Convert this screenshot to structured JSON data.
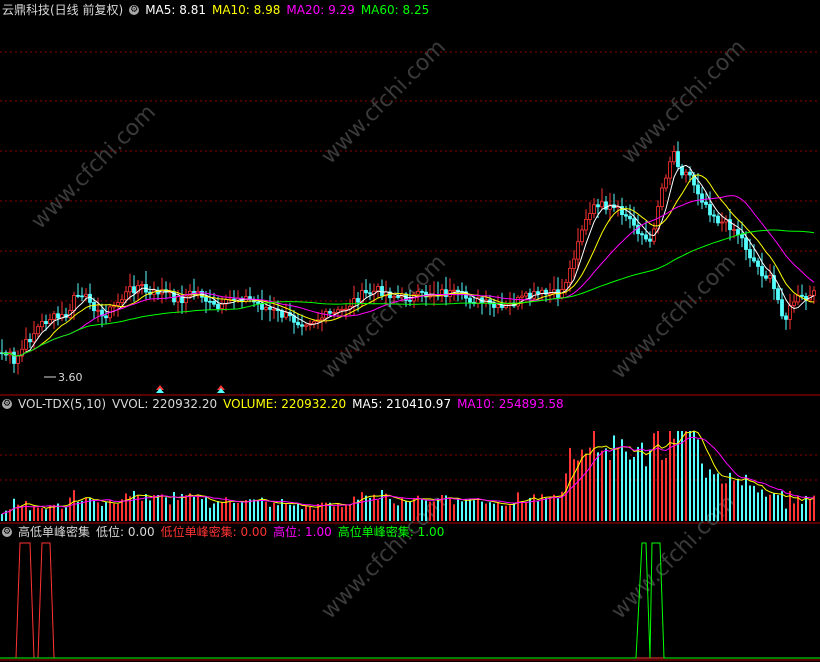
{
  "panels": {
    "price": {
      "legend": [
        {
          "text": "云鼎科技(日线 前复权)",
          "color": "#d8d8d8"
        },
        {
          "text": "MA5: 8.81",
          "color": "#ffffff"
        },
        {
          "text": "MA10: 8.98",
          "color": "#ffff00"
        },
        {
          "text": "MA20: 9.29",
          "color": "#ff00ff"
        },
        {
          "text": "MA60: 8.25",
          "color": "#00ff00"
        }
      ],
      "low_label": "3.60",
      "watermark": "www.cfchi.com"
    },
    "volume": {
      "legend": [
        {
          "text": "VOL-TDX(5,10)",
          "color": "#d8d8d8"
        },
        {
          "text": "VVOL: 220932.20",
          "color": "#d8d8d8"
        },
        {
          "text": "VOLUME: 220932.20",
          "color": "#ffff00"
        },
        {
          "text": "MA5: 210410.97",
          "color": "#ffffff"
        },
        {
          "text": "MA10: 254893.58",
          "color": "#ff00ff"
        }
      ]
    },
    "indicator": {
      "legend": [
        {
          "text": "高低单峰密集",
          "color": "#d8d8d8"
        },
        {
          "text": "低位: 0.00",
          "color": "#d8d8d8"
        },
        {
          "text": "低位单峰密集: 0.00",
          "color": "#ff3333"
        },
        {
          "text": "高位: 1.00",
          "color": "#ff00ff"
        },
        {
          "text": "高位单峰密集: 1.00",
          "color": "#00ff00"
        }
      ]
    }
  },
  "chart_data": {
    "type": "candlestick",
    "price_labels_shown": [
      "3.60"
    ],
    "ma_values": {
      "MA5": 8.81,
      "MA10": 8.98,
      "MA20": 9.29,
      "MA60": 8.25
    },
    "volume_values": {
      "VVOL": 220932.2,
      "VOLUME": 220932.2,
      "MA5": 210410.97,
      "MA10": 254893.58
    },
    "indicator_values": {
      "低位": 0.0,
      "低位单峰密集": 0.0,
      "高位": 1.0,
      "高位单峰密集": 1.0
    },
    "colors": {
      "up": "#ff3333",
      "down": "#54ffff",
      "ma5": "#ffffff",
      "ma10": "#ffff00",
      "ma20": "#ff00ff",
      "ma60": "#00ff00",
      "grid": "#8b0000"
    }
  }
}
